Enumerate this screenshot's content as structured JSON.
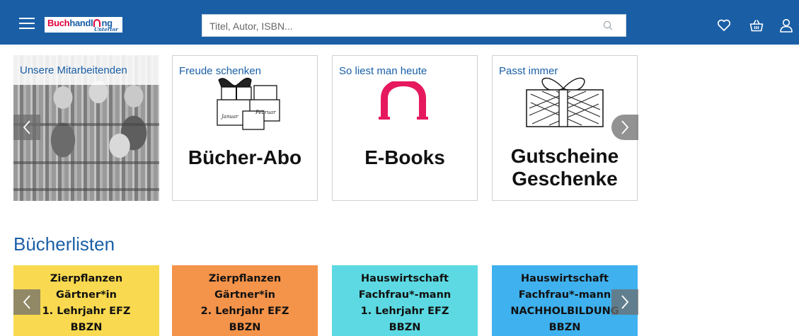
{
  "header": {
    "menu_icon": "hamburger-menu-icon",
    "logo": {
      "part1": "Buch",
      "part2": "handl",
      "part3": "ng",
      "subtitle": "Untertor"
    },
    "search": {
      "placeholder": "Titel, Autor, ISBN...",
      "value": "",
      "icon": "search-icon"
    },
    "actions": [
      {
        "icon": "heart-icon"
      },
      {
        "icon": "basket-icon"
      },
      {
        "icon": "user-icon"
      }
    ],
    "colors": {
      "bar": "#1a5fa6",
      "brand_red": "#e0003c"
    }
  },
  "promo": {
    "tiles": [
      {
        "title": "Unsere Mitarbeitenden"
      },
      {
        "title": "Freude schenken",
        "big_text": "Bücher-Abo",
        "doodle_labels": [
          "Januar",
          "Februar"
        ]
      },
      {
        "title": "So liest man heute",
        "big_text": "E-Books"
      },
      {
        "title": "Passt immer",
        "big_lines": [
          "Gutscheine",
          "Geschenke"
        ]
      }
    ],
    "prev_icon": "chevron-left-icon",
    "next_icon": "chevron-right-icon"
  },
  "booklists": {
    "title": "Bücherlisten",
    "items": [
      {
        "lines": [
          "Zierpflanzen",
          "Gärtner*in",
          "1. Lehrjahr EFZ",
          "BBZN"
        ],
        "color": "#f9d94f"
      },
      {
        "lines": [
          "Zierpflanzen",
          "Gärtner*in",
          "2. Lehrjahr EFZ",
          "BBZN"
        ],
        "color": "#f4934a"
      },
      {
        "lines": [
          "Hauswirtschaft",
          "Fachfrau*-mann",
          "1. Lehrjahr EFZ",
          "BBZN"
        ],
        "color": "#5cd9e2"
      },
      {
        "lines": [
          "Hauswirtschaft",
          "Fachfrau*-mann",
          "NACHHOLBILDUNG",
          "BBZN"
        ],
        "color": "#3fb1ee"
      }
    ]
  }
}
